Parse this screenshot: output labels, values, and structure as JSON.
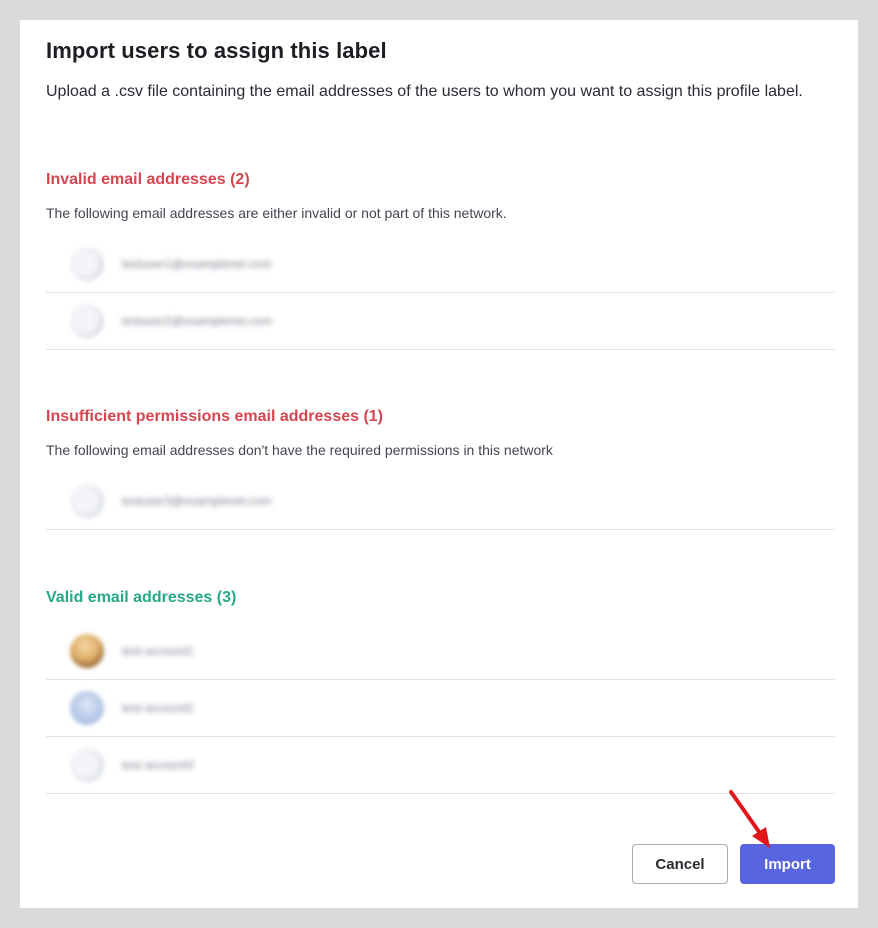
{
  "dialog": {
    "title": "Import users to assign this label",
    "description": "Upload a .csv file containing the email addresses of the users to whom you want to assign this profile label."
  },
  "sections": {
    "invalid": {
      "heading": "Invalid email addresses (2)",
      "subtext": "The following email addresses are either invalid or not part of this network.",
      "rows": [
        "testuser1@examplenet.com",
        "testuser2@examplenet.com"
      ]
    },
    "insufficient": {
      "heading": "Insufficient permissions email addresses (1)",
      "subtext": "The following email addresses don't have the required permissions in this network",
      "rows": [
        "testuser3@examplenet.com"
      ]
    },
    "valid": {
      "heading": "Valid email addresses (3)",
      "rows": [
        "test account1",
        "test account2",
        "test account3"
      ]
    }
  },
  "buttons": {
    "cancel_label": "Cancel",
    "import_label": "Import"
  },
  "colors": {
    "invalid_heading": "#d64550",
    "valid_heading": "#27a887",
    "primary_button": "#5865e0",
    "annotation_arrow": "#e0161b"
  }
}
